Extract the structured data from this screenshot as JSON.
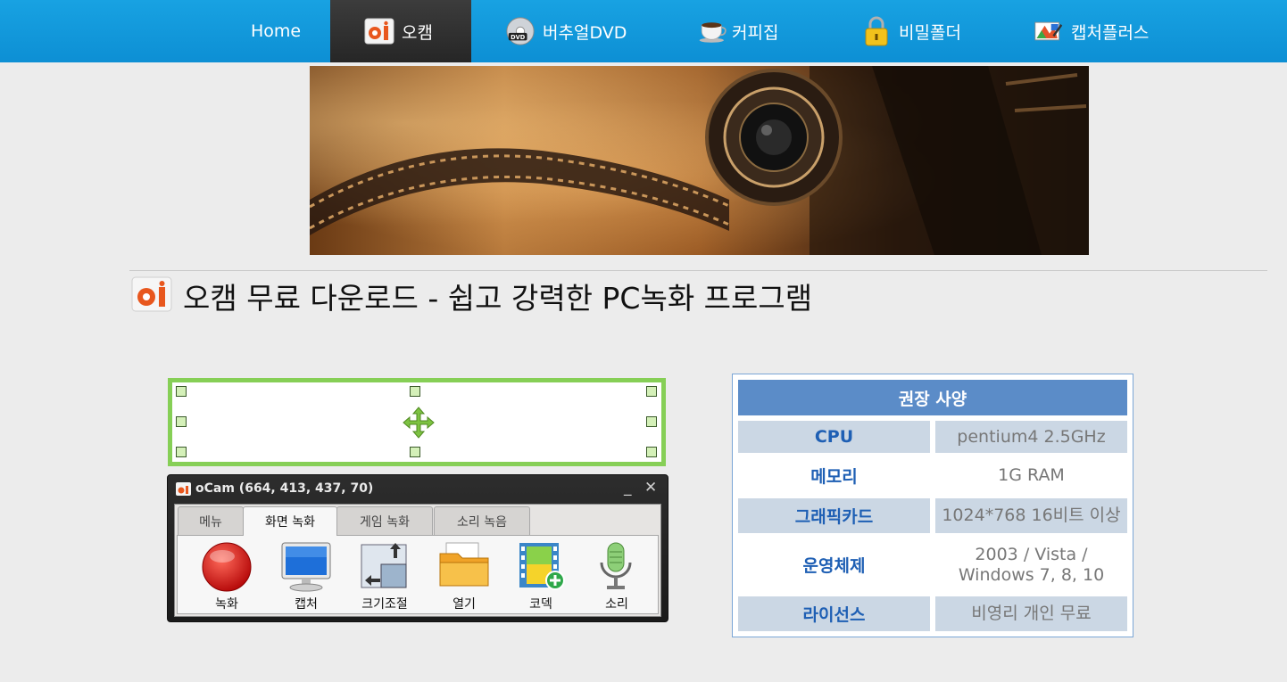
{
  "nav": {
    "items": [
      {
        "label": "Home",
        "icon": "",
        "active": false
      },
      {
        "label": "오캠",
        "icon": "ocam-icon",
        "active": true
      },
      {
        "label": "버추얼DVD",
        "icon": "dvd-icon",
        "active": false
      },
      {
        "label": "커피집",
        "icon": "coffee-cup-icon",
        "active": false
      },
      {
        "label": "비밀폴더",
        "icon": "lock-icon",
        "active": false
      },
      {
        "label": "캡처플러스",
        "icon": "capture-plus-icon",
        "active": false
      }
    ]
  },
  "page": {
    "title": "오캠 무료 다운로드 - 쉽고 강력한 PC녹화 프로그램"
  },
  "ocam": {
    "window_title": "oCam (664, 413, 437, 70)",
    "minimize": "_",
    "close": "✕",
    "tabs": [
      "메뉴",
      "화면 녹화",
      "게임 녹화",
      "소리 녹음"
    ],
    "active_tab": "화면 녹화",
    "tools": [
      {
        "label": "녹화",
        "icon": "record-icon"
      },
      {
        "label": "캡처",
        "icon": "monitor-icon"
      },
      {
        "label": "크기조절",
        "icon": "resize-icon"
      },
      {
        "label": "열기",
        "icon": "folder-icon"
      },
      {
        "label": "코덱",
        "icon": "codec-film-icon"
      },
      {
        "label": "소리",
        "icon": "microphone-icon"
      }
    ]
  },
  "spec": {
    "header": "권장 사양",
    "rows": [
      {
        "key": "CPU",
        "value": "pentium4 2.5GHz"
      },
      {
        "key": "메모리",
        "value": "1G RAM"
      },
      {
        "key": "그래픽카드",
        "value": "1024*768 16비트 이상"
      },
      {
        "key": "운영체제",
        "value": "2003 / Vista / Windows 7, 8, 10"
      },
      {
        "key": "라이선스",
        "value": "비영리 개인 무료"
      }
    ]
  },
  "colors": {
    "nav_bg": "#1399dc",
    "nav_active": "#2e2e2e",
    "frame_green": "#86cf56",
    "spec_header": "#5b8cc8",
    "spec_key": "#1e5fb4"
  }
}
